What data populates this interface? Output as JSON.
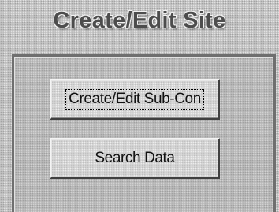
{
  "window": {
    "title": "Create/Edit Site"
  },
  "buttons": {
    "create_edit_sub_con": "Create/Edit Sub-Con",
    "search_data": "Search Data"
  },
  "focused_button": "create_edit_sub_con"
}
